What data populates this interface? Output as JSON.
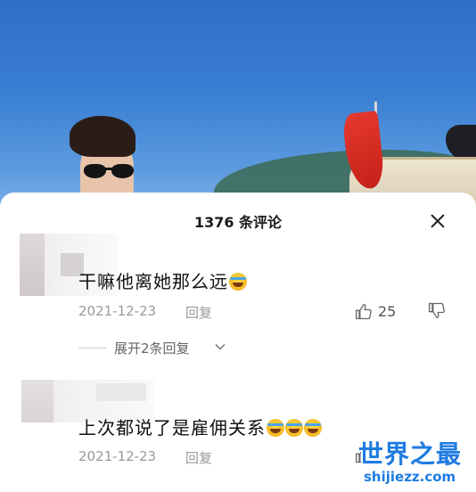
{
  "sheet": {
    "title": "1376 条评论",
    "close_icon": "close-icon"
  },
  "comments": [
    {
      "text": "干嘛他离她那么远",
      "emoji_count": 1,
      "date": "2021-12-23",
      "reply_label": "回复",
      "likes": "25",
      "expand_label": "展开2条回复"
    },
    {
      "text": "上次都说了是雇佣关系",
      "emoji_count": 3,
      "date": "2021-12-23",
      "reply_label": "回复"
    }
  ],
  "watermark": {
    "cn": "世界之最",
    "en": "shijiezz.com"
  },
  "colors": {
    "watermark": "#1e7be2",
    "meta_gray": "#9a9a9a"
  }
}
